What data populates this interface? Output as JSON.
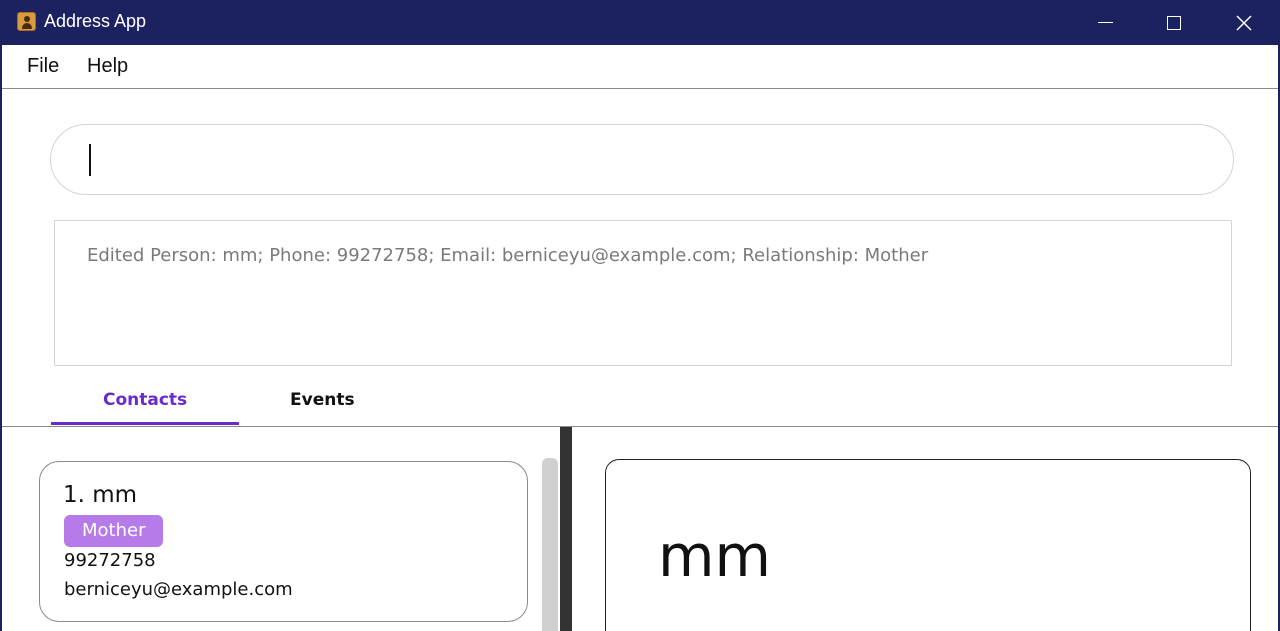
{
  "window": {
    "title": "Address App",
    "icon": "contact-book-icon"
  },
  "menu": {
    "items": [
      "File",
      "Help"
    ]
  },
  "command": {
    "value": "",
    "placeholder": ""
  },
  "result": {
    "text": "Edited Person: mm; Phone: 99272758; Email: berniceyu@example.com; Relationship: Mother"
  },
  "tabs": [
    {
      "label": "Contacts",
      "active": true
    },
    {
      "label": "Events",
      "active": false
    }
  ],
  "contacts": [
    {
      "index_name": "1. mm",
      "relationship": "Mother",
      "phone": "99272758",
      "email": "berniceyu@example.com"
    }
  ],
  "detail": {
    "name": "mm"
  },
  "colors": {
    "titlebar": "#1c2260",
    "accent": "#6a2bc9",
    "tag": "#b67be8"
  }
}
